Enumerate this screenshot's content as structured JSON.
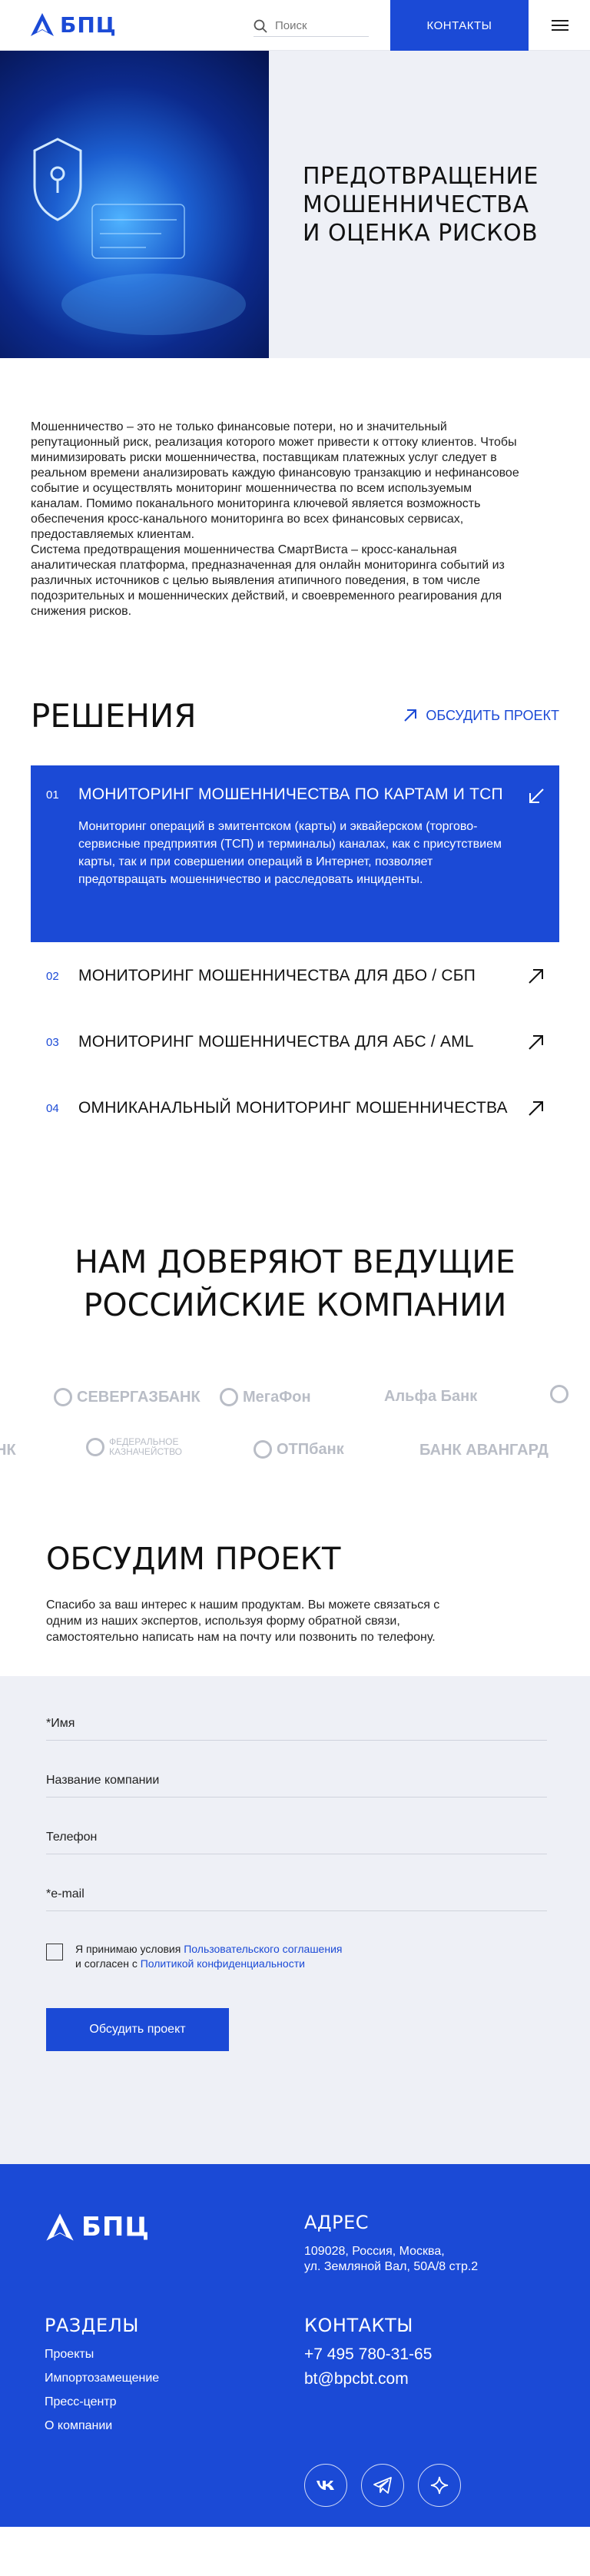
{
  "header": {
    "logo_text": "БПЦ",
    "search_placeholder": "Поиск",
    "contacts_label": "КОНТАКТЫ",
    "brand_color": "#1b4ad6"
  },
  "hero": {
    "title_lines": [
      "ПРЕДОТВРАЩЕНИЕ",
      "МОШЕННИЧЕСТВА",
      "И ОЦЕНКА РИСКОВ"
    ]
  },
  "intro": {
    "paragraph1": "Мошенничество – это не только финансовые потери, но и значительный репутационный риск, реализация которого может привести к оттоку клиентов. Чтобы минимизировать риски мошенничества, поставщикам платежных услуг следует в реальном времени анализировать каждую финансовую транзакцию и нефинансовое событие и осуществлять мониторинг мошенничества по всем используемым каналам. Помимо поканального мониторинга ключевой является возможность обеспечения кросс-канального мониторинга во всех финансовых сервисах, предоставляемых клиентам.",
    "paragraph2": "Система предотвращения мошенничества СмартВиста – кросс-канальная аналитическая платформа, предназначенная для онлайн мониторинга событий из различных источников с целью выявления атипичного поведения, в том числе подозрительных и мошеннических действий, и своевременного реагирования для снижения рисков."
  },
  "solutions": {
    "title": "РЕШЕНИЯ",
    "discuss_link": "ОБСУДИТЬ ПРОЕКТ",
    "items": [
      {
        "num": "01",
        "title": "МОНИТОРИНГ МОШЕННИЧЕСТВА ПО КАРТАМ И ТСП",
        "desc": "Мониторинг операций в эмитентском (карты) и эквайерском (торгово-сервисные предприятия (ТСП) и терминалы) каналах, как с присутствием карты, так и при совершении операций в Интернет, позволяет предотвращать мошенничество и расследовать инциденты."
      },
      {
        "num": "02",
        "title": "МОНИТОРИНГ МОШЕННИЧЕСТВА ДЛЯ ДБО / СБП"
      },
      {
        "num": "03",
        "title": "МОНИТОРИНГ МОШЕННИЧЕСТВА ДЛЯ АБС / AML"
      },
      {
        "num": "04",
        "title": "ОМНИКАНАЛЬНЫЙ МОНИТОРИНГ МОШЕННИЧЕСТВА"
      }
    ]
  },
  "trust": {
    "title_lines": [
      "НАМ ДОВЕРЯЮТ ВЕДУЩИЕ",
      "РОССИЙСКИЕ КОМПАНИИ"
    ],
    "row1": [
      "СЕВЕРГАЗБАНК",
      "МегаФон",
      "Альфа Банк"
    ],
    "row2": [
      "НК",
      "ФЕДЕРАЛЬНОЕ КАЗНАЧЕЙСТВО",
      "ОТПбанк",
      "БАНК АВАНГАРД"
    ]
  },
  "discuss": {
    "title": "ОБСУДИМ ПРОЕКТ",
    "text": "Спасибо за ваш интерес к нашим продуктам. Вы можете связаться с одним из наших экспертов, используя форму обратной связи, самостоятельно написать нам на почту или позвонить по телефону."
  },
  "form": {
    "name_label": "*Имя",
    "company_label": "Название компании",
    "phone_label": "Телефон",
    "email_label": "*e-mail",
    "agree_prefix": "Я принимаю условия ",
    "agree_link1": "Пользовательского соглашения",
    "agree_mid": "и согласен с ",
    "agree_link2": "Политикой конфиденциальности",
    "submit_label": "Обсудить проект"
  },
  "footer": {
    "logo_text": "БПЦ",
    "address_title": "АДРЕС",
    "address_line1": "109028, Россия, Москва,",
    "address_line2": "ул. Земляной Вал, 50А/8 стр.2",
    "sections_title": "РАЗДЕЛЫ",
    "sections": [
      "Проекты",
      "Импортозамещение",
      "Пресс-центр",
      "О компании"
    ],
    "contacts_title": "КОНТАКТЫ",
    "phone": "+7 495 780-31-65",
    "email": "bt@bpcbt.com",
    "social_icons": [
      "vk-icon",
      "telegram-icon",
      "star-icon"
    ]
  }
}
